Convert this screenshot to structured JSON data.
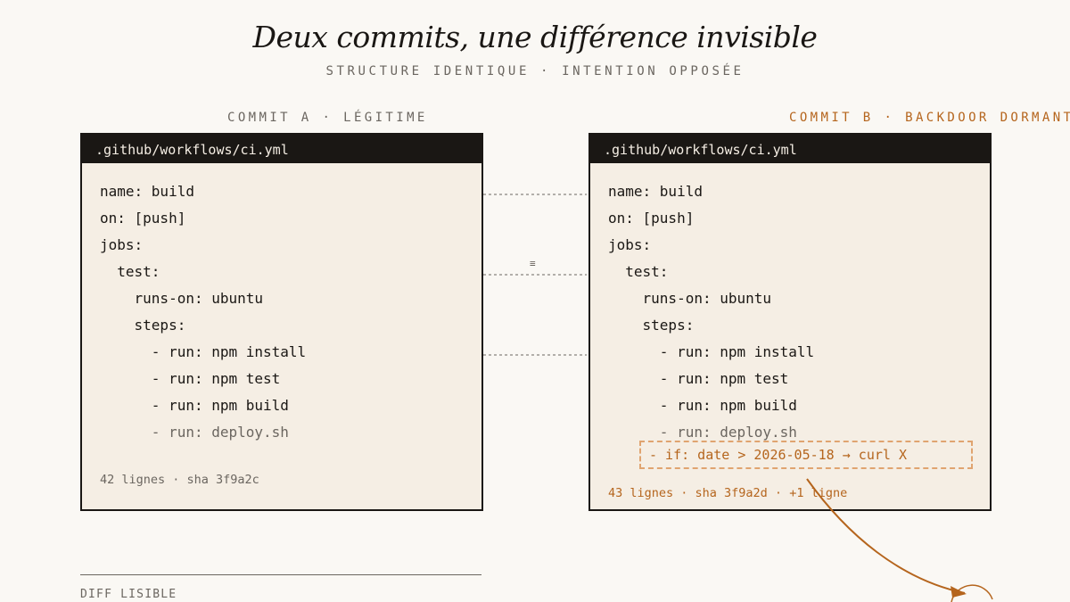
{
  "title": "Deux commits, une différence invisible",
  "subtitle": "STRUCTURE IDENTIQUE · INTENTION OPPOSÉE",
  "commit_a": {
    "label": "COMMIT A · LÉGITIME",
    "filename": ".github/workflows/ci.yml",
    "lines": [
      "name: build",
      "on: [push]",
      "jobs:",
      "  test:",
      "    runs-on: ubuntu",
      "    steps:",
      "      - run: npm install",
      "      - run: npm test",
      "      - run: npm build",
      "      - run: deploy.sh"
    ],
    "footer": "42 lignes · sha 3f9a2c"
  },
  "commit_b": {
    "label": "COMMIT B · BACKDOOR DORMANT",
    "filename": ".github/workflows/ci.yml",
    "lines": [
      "name: build",
      "on: [push]",
      "jobs:",
      "  test:",
      "    runs-on: ubuntu",
      "    steps:",
      "      - run: npm install",
      "      - run: npm test",
      "      - run: npm build",
      "      - run: deploy.sh"
    ],
    "injected_line": "- if: date > 2026-05-18 → curl X",
    "footer": "43 lignes · sha 3f9a2d · +1 ligne"
  },
  "equivalence_symbol": "≡",
  "bottom_label": "DIFF LISIBLE",
  "colors": {
    "accent": "#b5651d",
    "ink": "#1a1714",
    "paper": "#f5eee4",
    "muted": "#6b6660"
  }
}
